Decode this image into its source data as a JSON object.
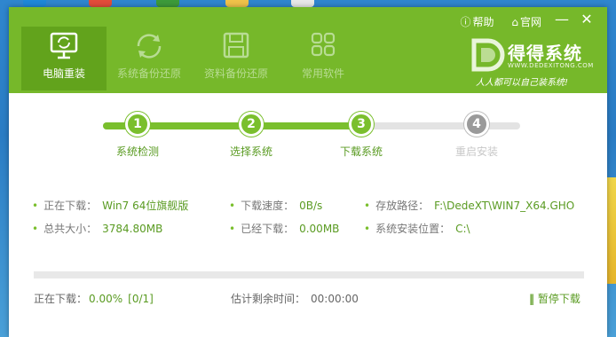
{
  "header": {
    "help_label": "帮助",
    "site_label": "官网",
    "minimize_symbol": "—",
    "close_symbol": "✕",
    "tabs": [
      {
        "label": "电脑重装",
        "icon": "monitor-refresh-icon",
        "active": true
      },
      {
        "label": "系统备份还原",
        "icon": "backup-restore-icon",
        "active": false
      },
      {
        "label": "资料备份还原",
        "icon": "save-disk-icon",
        "active": false
      },
      {
        "label": "常用软件",
        "icon": "apps-grid-icon",
        "active": false
      }
    ],
    "logo": {
      "name": "得得系统",
      "url": "WWW.DEDEXITONG.COM",
      "slogan": "人人都可以自己装系统!"
    }
  },
  "steps": [
    {
      "num": "1",
      "label": "系统检测",
      "state": "done"
    },
    {
      "num": "2",
      "label": "选择系统",
      "state": "done"
    },
    {
      "num": "3",
      "label": "下载系统",
      "state": "current"
    },
    {
      "num": "4",
      "label": "重启安装",
      "state": "todo"
    }
  ],
  "info": {
    "downloading_label": "正在下载：",
    "downloading_value": "Win7 64位旗舰版",
    "speed_label": "下载速度：",
    "speed_value": "0B/s",
    "path_label": "存放路径：",
    "path_value": "F:\\DedeXT\\WIN7_X64.GHO",
    "total_label": "总共大小：",
    "total_value": "3784.80MB",
    "downloaded_label": "已经下载：",
    "downloaded_value": "0.00MB",
    "install_label": "系统安装位置：",
    "install_value": "C:\\"
  },
  "progress": {
    "fraction": 0.0,
    "status_label": "正在下载：",
    "percent_value": "0.00%",
    "count_value": "[0/1]",
    "remaining_label": "估计剩余时间：",
    "remaining_value": "00:00:00",
    "pause_label": "暂停下载"
  },
  "colors": {
    "accent": "#76b82a",
    "accent_dark": "#62a31c",
    "text_green": "#5a9b22",
    "inactive_step": "#9a9a9a"
  }
}
